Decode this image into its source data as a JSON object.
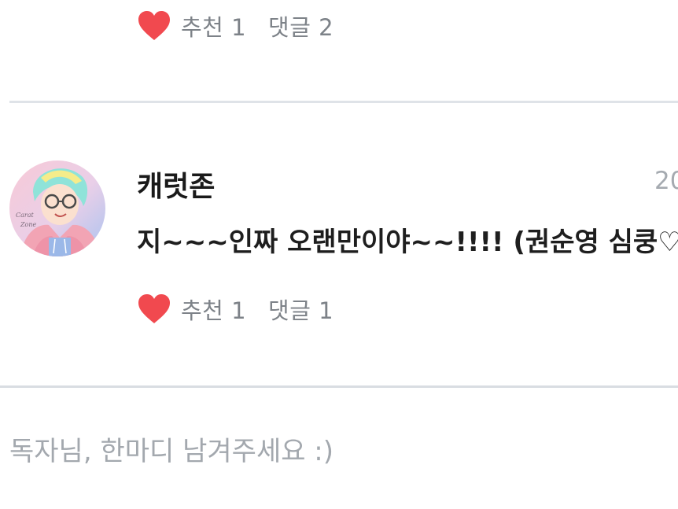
{
  "previous_comment": {
    "like_label": "추천 1",
    "reply_label": "댓글 2"
  },
  "comment": {
    "username": "캐럿존",
    "date": "20",
    "text": "지~~~인짜 오랜만이야~~!!!! (권순영 심쿵♡)",
    "like_label": "추천 1",
    "reply_label": "댓글 1",
    "avatar_signature": "Carat Zone"
  },
  "reply_input": {
    "placeholder": "독자님, 한마디 남겨주세요 :)"
  },
  "colors": {
    "heart": "#f1494f",
    "meta_text": "#7d8288",
    "divider": "#dfe3e8",
    "placeholder": "#a3a8ae"
  },
  "icons": [
    "heart-icon"
  ]
}
